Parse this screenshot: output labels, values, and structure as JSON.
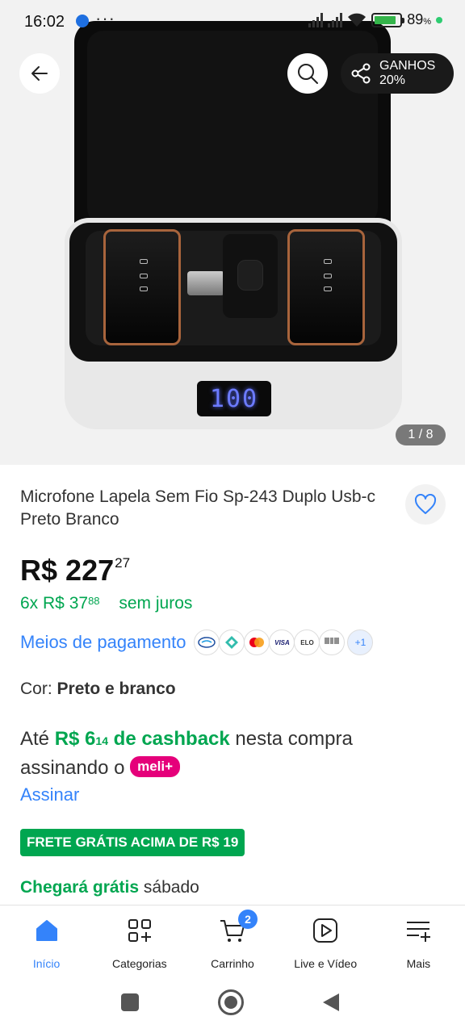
{
  "status_bar": {
    "time": "16:02",
    "dots": "···",
    "battery_pct": "89",
    "battery_pct_symbol": "%"
  },
  "hero": {
    "share_label_line1": "GANHOS",
    "share_label_line2": "20%",
    "display_text": "100",
    "image_counter": "1 / 8"
  },
  "product": {
    "title": "Microfone Lapela Sem Fio Sp-243 Duplo Usb-c Preto Branco",
    "currency": "R$",
    "price_int": "227",
    "price_cents": "27",
    "installments_prefix": "6x R$ 37",
    "installments_cents": "88",
    "installments_suffix": "sem juros",
    "payment_label": "Meios de pagamento",
    "payment_methods": [
      "Mercado Pago",
      "Pix",
      "Mastercard",
      "VISA",
      "ELO",
      "Boleto"
    ],
    "payment_more": "+1",
    "color_label": "Cor:",
    "color_value": "Preto e branco",
    "cashback_prefix": "Até",
    "cashback_amount_int": "R$ 6",
    "cashback_amount_cents": "14",
    "cashback_word": "de cashback",
    "cashback_mid": "nesta compra assinando o",
    "meli_badge": "meli+",
    "subscribe_link": "Assinar",
    "free_shipping_badge": "FRETE GRÁTIS ACIMA DE R$ 19",
    "arrival_highlight": "Chegará grátis",
    "arrival_day": "sábado"
  },
  "bottom_nav": {
    "items": [
      {
        "label": "Início",
        "icon": "home-icon"
      },
      {
        "label": "Categorias",
        "icon": "categories-icon"
      },
      {
        "label": "Carrinho",
        "icon": "cart-icon",
        "badge": "2"
      },
      {
        "label": "Live e Vídeo",
        "icon": "play-icon"
      },
      {
        "label": "Mais",
        "icon": "menu-plus-icon"
      }
    ]
  },
  "colors": {
    "accent_blue": "#3483fa",
    "green": "#00a650",
    "meli_pink": "#e5007a"
  }
}
